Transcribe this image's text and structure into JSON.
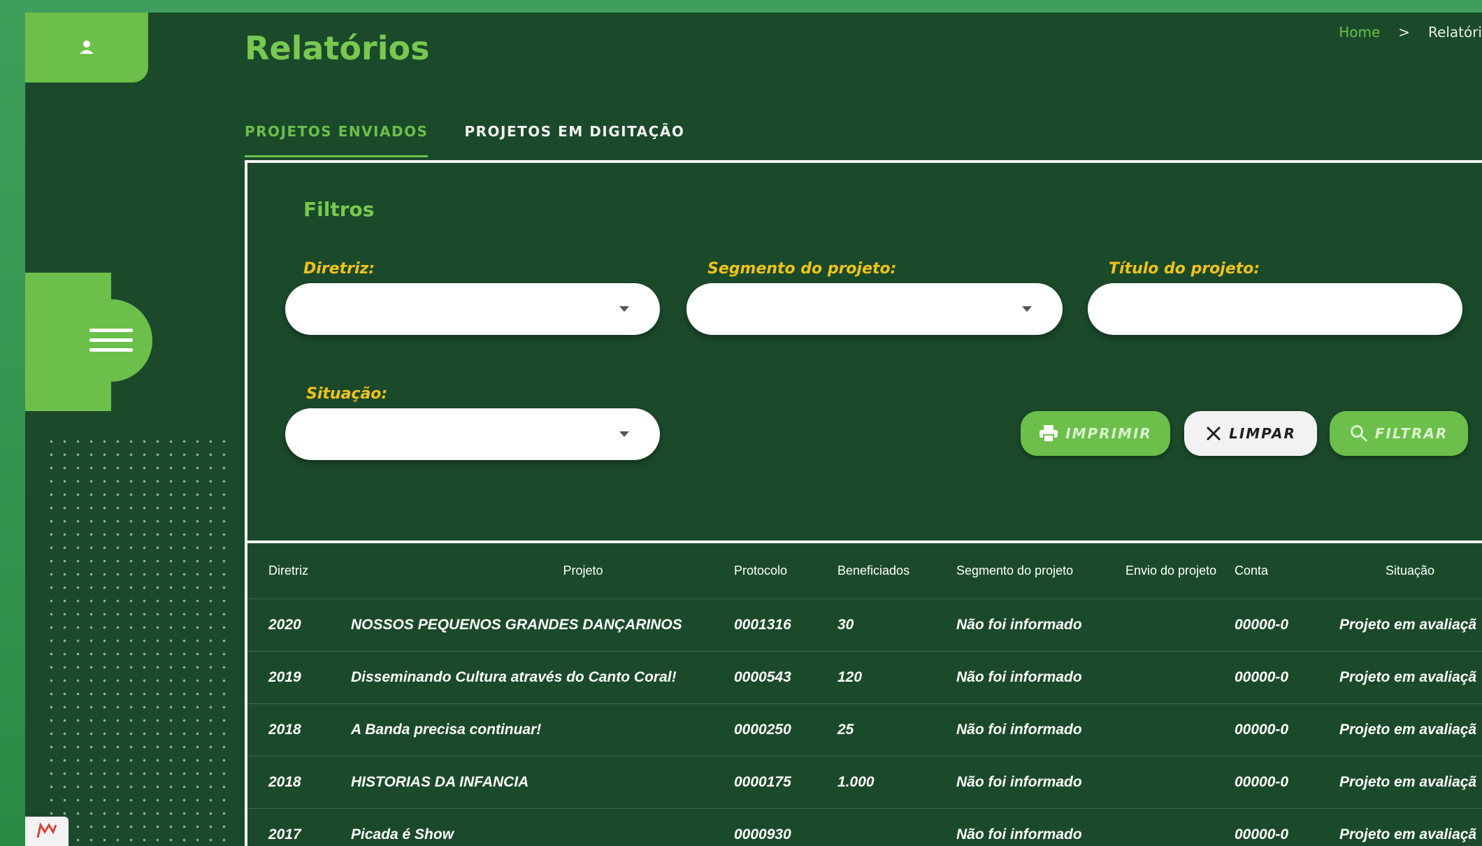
{
  "header": {
    "title": "Relatórios",
    "breadcrumb": {
      "home": "Home",
      "separator": ">",
      "current": "Relatóri"
    }
  },
  "tabs": [
    {
      "label": "PROJETOS ENVIADOS",
      "active": true
    },
    {
      "label": "PROJETOS EM DIGITAÇÃO",
      "active": false
    }
  ],
  "filters": {
    "title": "Filtros",
    "diretriz": {
      "label": "Diretriz:",
      "value": ""
    },
    "segmento": {
      "label": "Segmento do projeto:",
      "value": ""
    },
    "titulo": {
      "label": "Título do projeto:",
      "value": ""
    },
    "situacao": {
      "label": "Situação:",
      "value": ""
    },
    "buttons": {
      "print": "IMPRIMIR",
      "clear": "LIMPAR",
      "filter": "FILTRAR"
    }
  },
  "table": {
    "columns": [
      "Diretriz",
      "Projeto",
      "Protocolo",
      "Beneficiados",
      "Segmento do projeto",
      "Envio do projeto",
      "Conta",
      "Situação"
    ],
    "rows": [
      [
        "2020",
        "NOSSOS PEQUENOS GRANDES DANÇARINOS",
        "0001316",
        "30",
        "Não foi informado",
        "",
        "00000-0",
        "Projeto em avaliaçã"
      ],
      [
        "2019",
        "Disseminando Cultura através do Canto Coral!",
        "0000543",
        "120",
        "Não foi informado",
        "",
        "00000-0",
        "Projeto em avaliaçã"
      ],
      [
        "2018",
        "A Banda precisa continuar!",
        "0000250",
        "25",
        "Não foi informado",
        "",
        "00000-0",
        "Projeto em avaliaçã"
      ],
      [
        "2018",
        "HISTORIAS DA INFANCIA",
        "0000175",
        "1.000",
        "Não foi informado",
        "",
        "00000-0",
        "Projeto em avaliaçã"
      ],
      [
        "2017",
        "Picada é Show",
        "0000930",
        "",
        "Não foi informado",
        "",
        "00000-0",
        "Projeto em avaliaçã"
      ]
    ]
  },
  "colors": {
    "background": "#1b4a2a",
    "accent_green": "#6cbf4b",
    "label_yellow": "#f1c21b",
    "outer_gradient": "#3f9e5b"
  },
  "icons": [
    "user-icon",
    "hamburger-menu-icon",
    "printer-icon",
    "close-x-icon",
    "search-icon",
    "logo-badge-icon"
  ]
}
